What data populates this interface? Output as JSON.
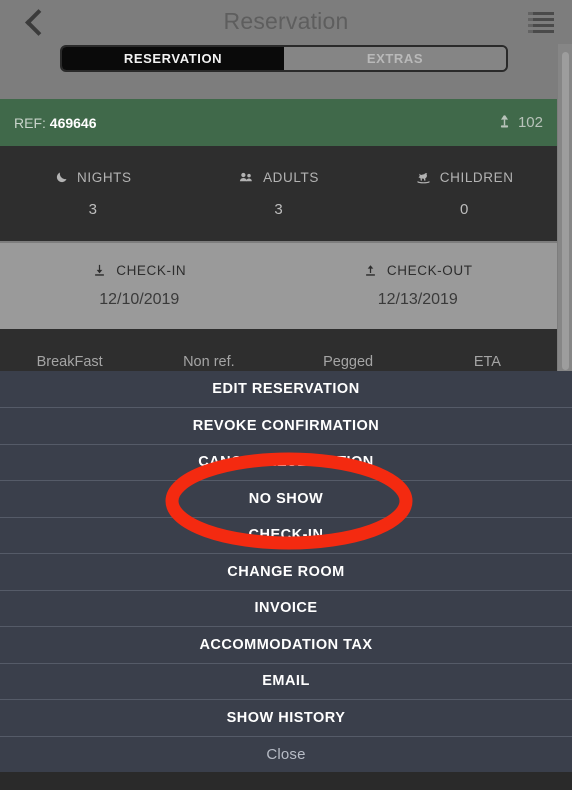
{
  "header": {
    "title": "Reservation",
    "back_icon": "chevron-left-icon",
    "menu_icon": "list-icon"
  },
  "tabs": [
    {
      "label": "RESERVATION",
      "selected": true
    },
    {
      "label": "EXTRAS",
      "selected": false
    }
  ],
  "reference": {
    "label": "REF:",
    "value": "469646",
    "room_icon": "bed-lamp-icon",
    "room_number": "102",
    "bar_color": "#40694a"
  },
  "stats": [
    {
      "icon": "moon-icon",
      "label": "NIGHTS",
      "value": "3"
    },
    {
      "icon": "adults-icon",
      "label": "ADULTS",
      "value": "3"
    },
    {
      "icon": "rocking-horse-icon",
      "label": "CHILDREN",
      "value": "0"
    }
  ],
  "dates": [
    {
      "icon": "download-arrow-icon",
      "label": "CHECK-IN",
      "value": "12/10/2019"
    },
    {
      "icon": "upload-arrow-icon",
      "label": "CHECK-OUT",
      "value": "12/13/2019"
    }
  ],
  "tags": [
    {
      "label": "BreakFast"
    },
    {
      "label": "Non ref."
    },
    {
      "label": "Pegged"
    },
    {
      "label": "ETA"
    }
  ],
  "action_sheet": {
    "items": [
      {
        "label": "EDIT RESERVATION"
      },
      {
        "label": "REVOKE CONFIRMATION"
      },
      {
        "label": "CANCEL RESERVATION"
      },
      {
        "label": "NO SHOW"
      },
      {
        "label": "CHECK-IN"
      },
      {
        "label": "CHANGE ROOM"
      },
      {
        "label": "INVOICE"
      },
      {
        "label": "ACCOMMODATION TAX"
      },
      {
        "label": "EMAIL"
      },
      {
        "label": "SHOW HISTORY"
      }
    ],
    "close_label": "Close"
  },
  "annotation": {
    "shape": "ellipse",
    "color": "#f42a10",
    "targets": "NO SHOW"
  },
  "colors": {
    "page_background": "#7d7d7d",
    "dark_band": "#2e2e2e",
    "light_band": "#9a9a9a",
    "sheet_background": "#3a3f4b",
    "accent_green": "#40694a"
  }
}
